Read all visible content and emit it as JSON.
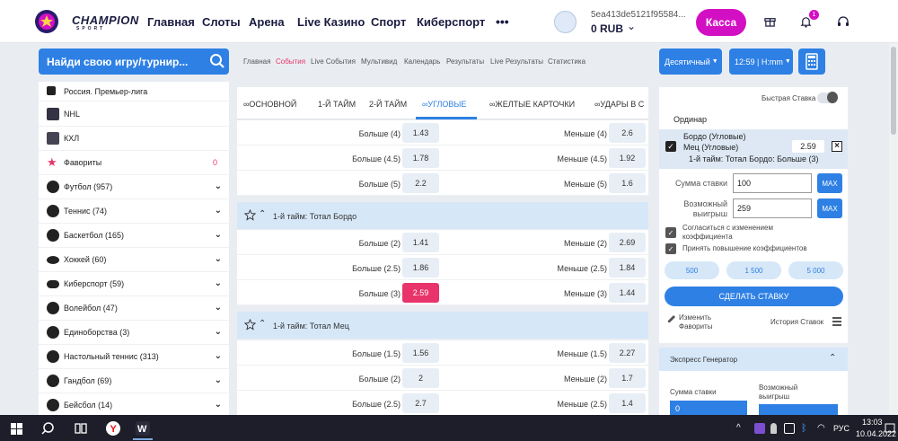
{
  "header": {
    "brand": "CHAMPION",
    "brand_sub": "SPORT",
    "nav": [
      "Главная",
      "Слоты",
      "Арена",
      "Live Казино",
      "Спорт",
      "Киберспорт"
    ],
    "more": "•••",
    "user_id": "5ea413de5121f95584...",
    "balance": "0 RUB",
    "kassa": "Касса",
    "notifications": "1",
    "accent_color": "#d30fc4"
  },
  "search": {
    "placeholder": "Найди свою игру/турнир..."
  },
  "subnav": [
    "Главная",
    "События",
    "Live События",
    "Мультивид",
    "Календарь",
    "Результаты",
    "Live Результаты",
    "Статистика"
  ],
  "dropdowns": {
    "odds_format": "Десятичный",
    "time_format": "12:59 | H:mm"
  },
  "sidebar": {
    "items": [
      {
        "label": "Россия. Премьер-лига",
        "icon": "league-icon",
        "expandable": false
      },
      {
        "label": "NHL",
        "icon": "nhl-icon",
        "expandable": false
      },
      {
        "label": "КХЛ",
        "icon": "khl-icon",
        "expandable": false
      },
      {
        "label": "Фавориты",
        "icon": "star-icon",
        "count": "0",
        "expandable": false
      },
      {
        "label": "Футбол (957)",
        "icon": "football-icon",
        "expandable": true
      },
      {
        "label": "Теннис (74)",
        "icon": "tennis-icon",
        "expandable": true
      },
      {
        "label": "Баскетбол (165)",
        "icon": "basketball-icon",
        "expandable": true
      },
      {
        "label": "Хоккей (60)",
        "icon": "hockey-icon",
        "expandable": true
      },
      {
        "label": "Киберспорт (59)",
        "icon": "gamepad-icon",
        "expandable": true
      },
      {
        "label": "Волейбол (47)",
        "icon": "volleyball-icon",
        "expandable": true
      },
      {
        "label": "Единоборства (3)",
        "icon": "fighting-icon",
        "expandable": true
      },
      {
        "label": "Настольный теннис (313)",
        "icon": "table-tennis-icon",
        "expandable": true
      },
      {
        "label": "Гандбол (69)",
        "icon": "handball-icon",
        "expandable": true
      },
      {
        "label": "Бейсбол (14)",
        "icon": "baseball-icon",
        "expandable": true
      }
    ]
  },
  "market_tabs": [
    "ОСНОВНОЙ",
    "1-Й ТАЙМ",
    "2-Й ТАЙМ",
    "УГЛОВЫЕ",
    "ЖЕЛТЫЕ КАРТОЧКИ",
    "УДАРЫ В С"
  ],
  "markets": {
    "top_rows": [
      {
        "left": "Больше (4)",
        "left_odd": "1.43",
        "right": "Меньше (4)",
        "right_odd": "2.6"
      },
      {
        "left": "Больше (4.5)",
        "left_odd": "1.78",
        "right": "Меньше (4.5)",
        "right_odd": "1.92"
      },
      {
        "left": "Больше (5)",
        "left_odd": "2.2",
        "right": "Меньше (5)",
        "right_odd": "1.6"
      }
    ],
    "group1": {
      "title": "1-й тайм: Тотал Бордо",
      "rows": [
        {
          "left": "Больше (2)",
          "left_odd": "1.41",
          "right": "Меньше (2)",
          "right_odd": "2.69"
        },
        {
          "left": "Больше (2.5)",
          "left_odd": "1.86",
          "right": "Меньше (2.5)",
          "right_odd": "1.84"
        },
        {
          "left": "Больше (3)",
          "left_odd": "2.59",
          "right": "Меньше (3)",
          "right_odd": "1.44"
        }
      ]
    },
    "group2": {
      "title": "1-й тайм: Тотал Мец",
      "rows": [
        {
          "left": "Больше (1.5)",
          "left_odd": "1.56",
          "right": "Меньше (1.5)",
          "right_odd": "2.27"
        },
        {
          "left": "Больше (2)",
          "left_odd": "2",
          "right": "Меньше (2)",
          "right_odd": "1.7"
        },
        {
          "left": "Больше (2.5)",
          "left_odd": "2.7",
          "right": "Меньше (2.5)",
          "right_odd": "1.4"
        }
      ]
    }
  },
  "betslip": {
    "quick_bet": "Быстрая Ставка",
    "tab": "Ординар",
    "match_line1": "Бордо (Угловые)",
    "match_line2": "Мец (Угловые)",
    "market": "1-й тайм: Тотал Бордо: Больше (3)",
    "odd": "2.59",
    "stake_label": "Сумма ставки",
    "stake_value": "100",
    "win_label_1": "Возможный",
    "win_label_2": "выигрыш",
    "win_value": "259",
    "max": "MAX",
    "accept_1": "Согласиться с изменением",
    "accept_2": "коэффициента",
    "accept_raise": "Принять повышение коэффициентов",
    "quick_amounts": [
      "500",
      "1 500",
      "5 000"
    ],
    "place_bet": "СДЕЛАТЬ СТАВКУ",
    "edit_fav_1": "Изменить",
    "edit_fav_2": "Фавориты",
    "history": "История Ставок"
  },
  "express": {
    "title": "Экспресс Генератор",
    "stake_label": "Сумма ставки",
    "win_label_1": "Возможный",
    "win_label_2": "выигрыш",
    "stake_value": "0"
  },
  "taskbar": {
    "lang": "РУС",
    "time": "13:03",
    "date": "10.04.2022"
  }
}
